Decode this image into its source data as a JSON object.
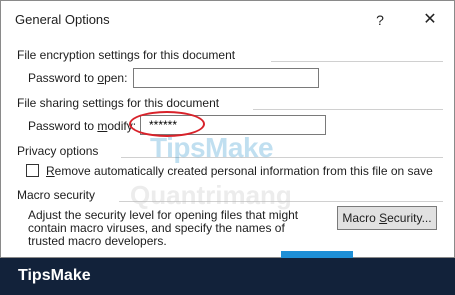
{
  "dialog": {
    "title": "General Options",
    "help_glyph": "?",
    "close_glyph": "✕"
  },
  "encryption": {
    "header": "File encryption settings for this document",
    "label_pre": "Password to ",
    "label_accel": "o",
    "label_post": "pen:",
    "value": ""
  },
  "sharing": {
    "header": "File sharing settings for this document",
    "label_pre": "Password to ",
    "label_accel": "m",
    "label_post": "odify:",
    "value": "******"
  },
  "privacy": {
    "header": "Privacy options",
    "checkbox_pre": "",
    "checkbox_accel": "R",
    "checkbox_post": "emove automatically created personal information from this file on save",
    "checked": false
  },
  "macro": {
    "header": "Macro security",
    "description": "Adjust the security level for opening files that might contain macro viruses, and specify the names of trusted macro developers.",
    "button_pre": "Macro ",
    "button_accel": "S",
    "button_post": "ecurity..."
  },
  "watermark": {
    "brand": "TipsMake",
    "secondary": "Quantrimang"
  },
  "footer": {
    "brand": "TipsMake"
  },
  "colors": {
    "highlight": "#d8222a",
    "accent": "#1e8fd6",
    "footer_bg": "#12223a"
  }
}
